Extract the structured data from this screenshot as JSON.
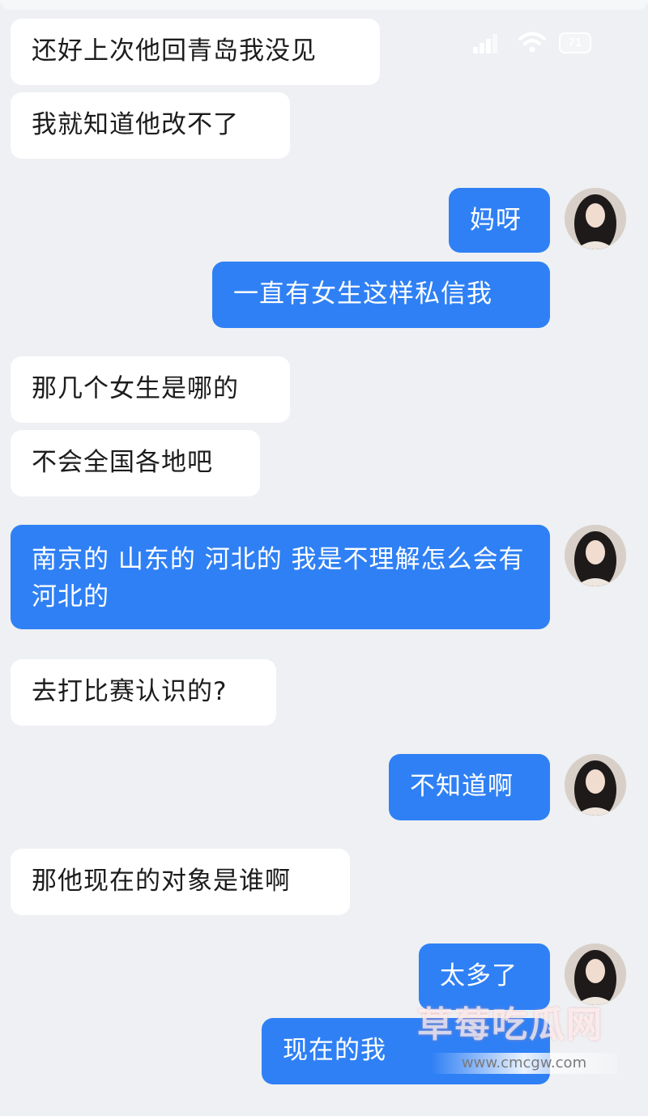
{
  "status_bar": {
    "battery_level": "71",
    "signal_icon": "signal-bars-icon",
    "wifi_icon": "wifi-icon",
    "battery_icon": "battery-icon"
  },
  "messages": [
    {
      "side": "received",
      "text": "还好上次他回青岛我没见"
    },
    {
      "side": "received",
      "text": "我就知道他改不了"
    },
    {
      "side": "sent",
      "text": "妈呀"
    },
    {
      "side": "sent",
      "text": "一直有女生这样私信我"
    },
    {
      "side": "received",
      "text": "那几个女生是哪的"
    },
    {
      "side": "received",
      "text": "不会全国各地吧"
    },
    {
      "side": "sent",
      "text": "南京的 山东的 河北的 我是不理解怎么会有河北的"
    },
    {
      "side": "received",
      "text": "去打比赛认识的?"
    },
    {
      "side": "sent",
      "text": "不知道啊"
    },
    {
      "side": "received",
      "text": "那他现在的对象是谁啊"
    },
    {
      "side": "sent",
      "text": "太多了"
    },
    {
      "side": "sent",
      "text": "现在的我"
    }
  ],
  "watermark": {
    "title": "草莓吃瓜网",
    "url": "www.cmcgw.com"
  },
  "colors": {
    "background": "#eef0f3",
    "sent_bubble": "#2f80f5",
    "received_bubble": "#ffffff"
  }
}
